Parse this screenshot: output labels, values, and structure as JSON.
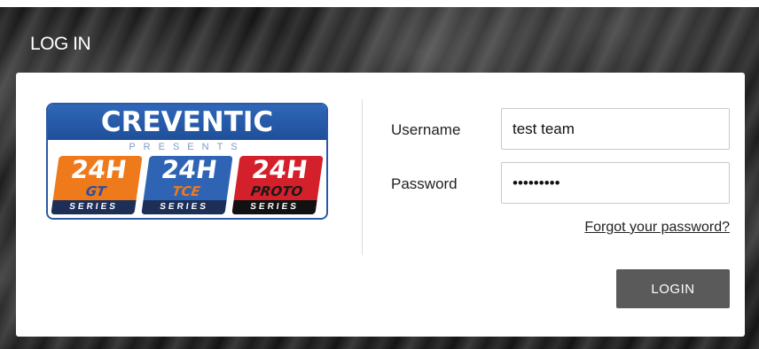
{
  "header": {
    "title": "LOG IN"
  },
  "logo": {
    "brand": "CREVENTIC",
    "presents": "PRESENTS",
    "badges": [
      {
        "big": "24H",
        "sub": "GT",
        "series": "SERIES"
      },
      {
        "big": "24H",
        "sub": "TCE",
        "series": "SERIES"
      },
      {
        "big": "24H",
        "sub": "PROTO",
        "series": "SERIES"
      }
    ]
  },
  "form": {
    "username_label": "Username",
    "username_value": "test team",
    "password_label": "Password",
    "password_value": "•••••••••",
    "forgot_link": "Forgot your password?",
    "login_button": "LOGIN"
  },
  "colors": {
    "brand_blue": "#2a5aa7",
    "gt_orange": "#ee7a1c",
    "proto_red": "#d4202a",
    "button": "#5a5a5a"
  }
}
